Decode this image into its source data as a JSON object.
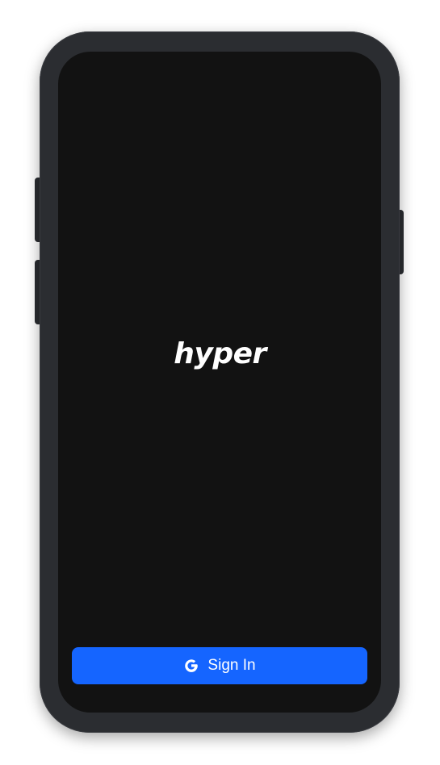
{
  "app": {
    "logo_text": "hyper"
  },
  "auth": {
    "signin_label": "Sign In",
    "signin_icon": "google-icon"
  },
  "colors": {
    "screen_background": "#121212",
    "button_accent": "#1565ff",
    "frame": "#2b2d31"
  }
}
